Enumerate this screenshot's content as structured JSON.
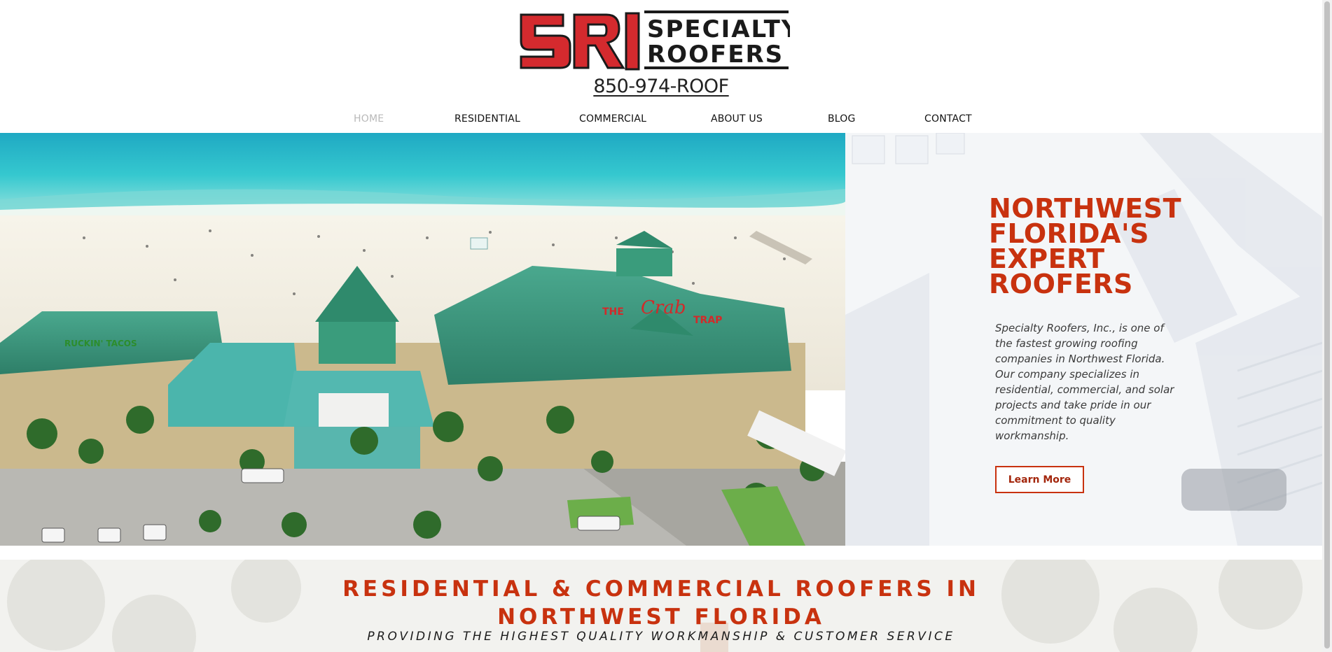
{
  "brand": {
    "logo_mark": "SRI",
    "logo_line1": "SPECIALTY",
    "logo_line2": "ROOFERS",
    "phone": "850-974-ROOF",
    "accent_color": "#c8320f"
  },
  "nav": {
    "items": [
      {
        "label": "HOME",
        "active": true
      },
      {
        "label": "RESIDENTIAL",
        "active": false
      },
      {
        "label": "COMMERCIAL",
        "active": false
      },
      {
        "label": "ABOUT US",
        "active": false
      },
      {
        "label": "BLOG",
        "active": false
      },
      {
        "label": "CONTACT",
        "active": false
      }
    ]
  },
  "hero": {
    "photo_signs": {
      "left_sign": "RUCKIN' TACOS",
      "crab_the": "THE",
      "crab_name": "Crab",
      "crab_trap": "TRAP"
    },
    "headline": [
      "NORTHWEST",
      "FLORIDA'S",
      "EXPERT",
      "ROOFERS"
    ],
    "intro": "Specialty Roofers, Inc., is one of the fastest growing roofing companies in Northwest Florida. Our company specializes in residential, commercial, and solar projects and take pride in our commitment to quality workmanship.",
    "cta_label": "Learn More"
  },
  "band": {
    "title_line1": "RESIDENTIAL & COMMERCIAL ROOFERS IN",
    "title_line2": "NORTHWEST FLORIDA",
    "subtitle": "PROVIDING THE HIGHEST QUALITY WORKMANSHIP & CUSTOMER SERVICE"
  }
}
